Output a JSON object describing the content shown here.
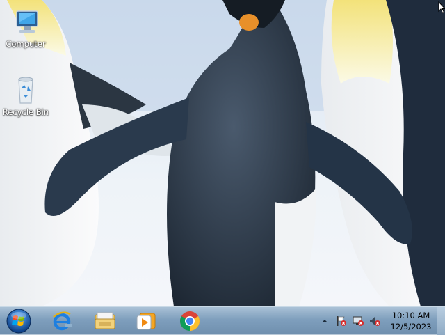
{
  "desktop": {
    "icons": [
      {
        "label": "Computer",
        "icon": "computer-icon"
      },
      {
        "label": "Recycle Bin",
        "icon": "recycle-bin-icon"
      }
    ],
    "wallpaper": "penguins"
  },
  "taskbar": {
    "pinned": [
      {
        "name": "internet-explorer",
        "icon": "internet-explorer-icon"
      },
      {
        "name": "windows-explorer",
        "icon": "folder-icon"
      },
      {
        "name": "media-player",
        "icon": "media-player-icon"
      },
      {
        "name": "google-chrome",
        "icon": "chrome-icon"
      }
    ],
    "tray": {
      "icons": [
        "show-hidden-icons-arrow",
        "action-center-flag-icon",
        "network-icon",
        "volume-muted-icon"
      ],
      "time": "10:10 AM",
      "date": "12/5/2023"
    }
  },
  "colors": {
    "taskbar": "#7f9fbd",
    "accent": "#1e6fd0"
  }
}
